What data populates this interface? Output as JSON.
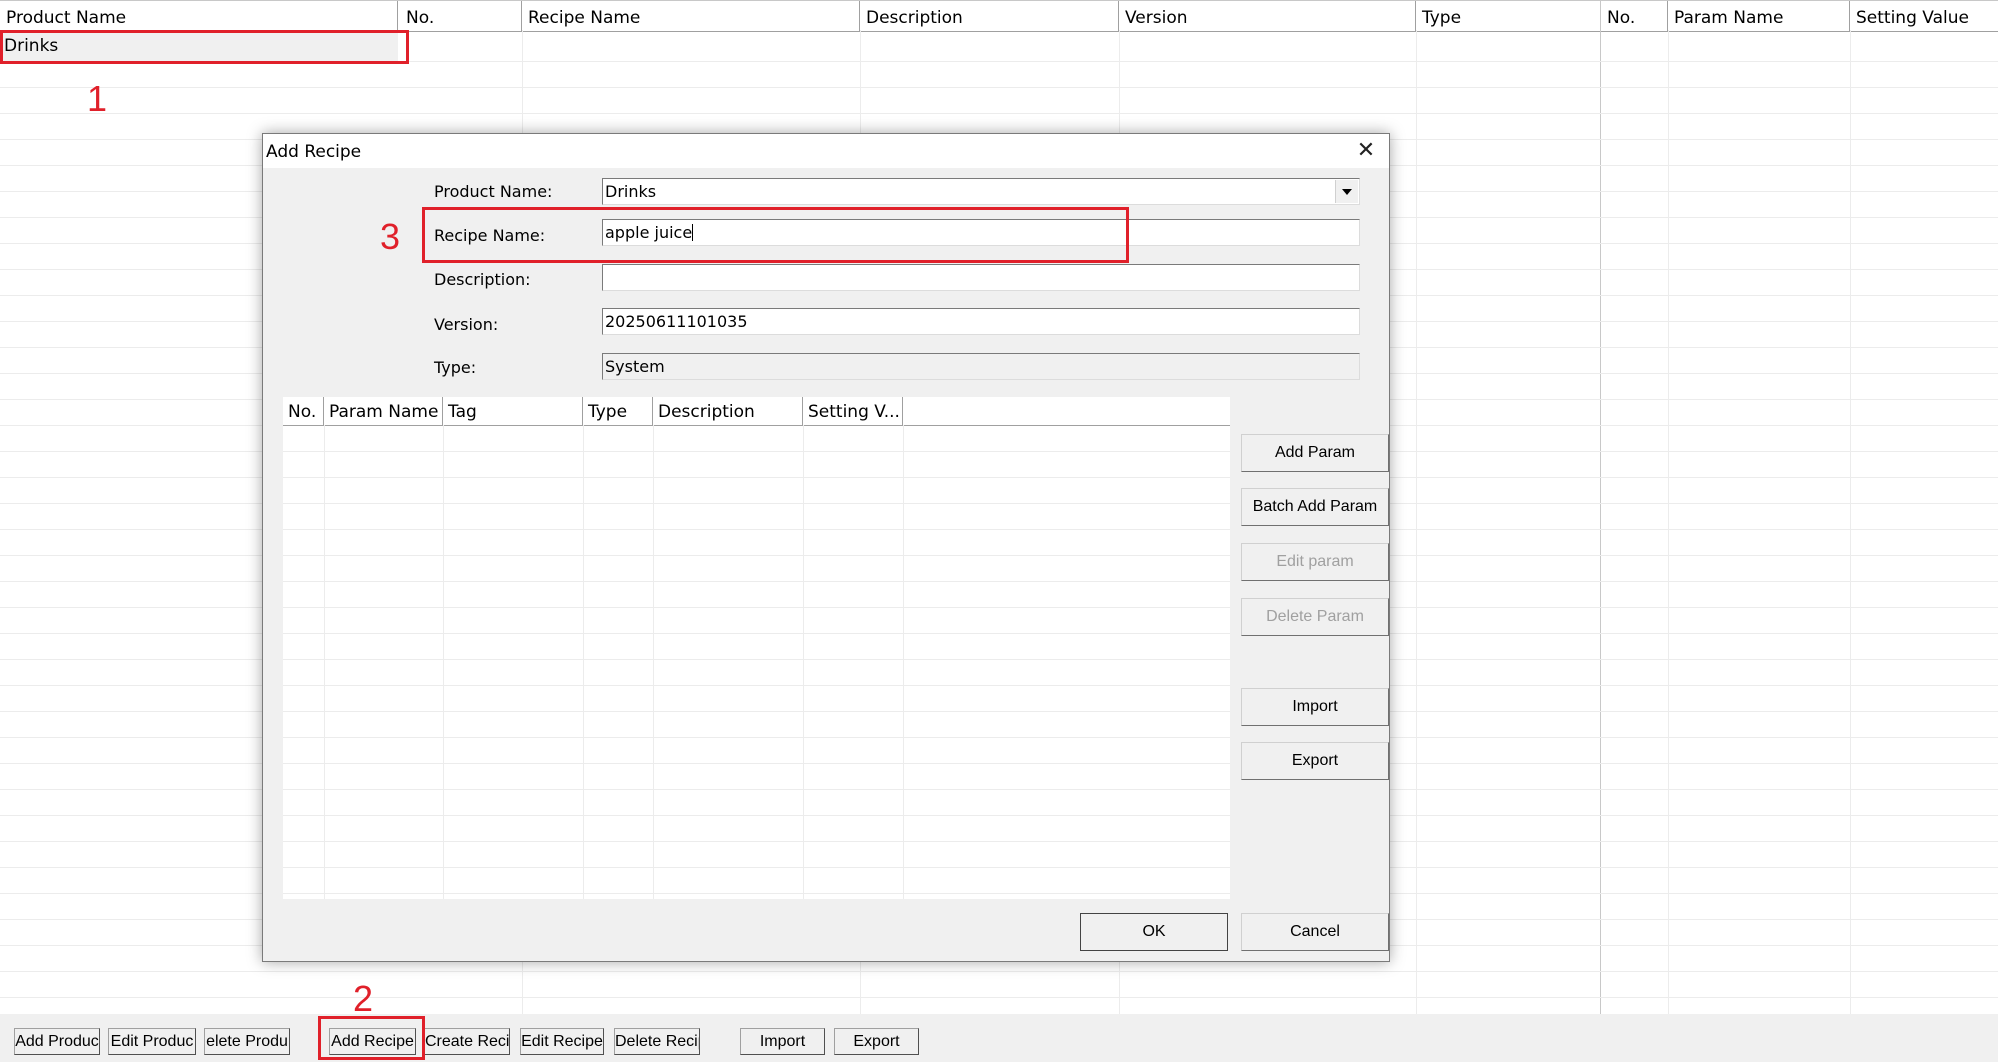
{
  "products_grid": {
    "header": "Product Name",
    "rows": [
      "Drinks"
    ]
  },
  "recipes_grid": {
    "headers": [
      "No.",
      "Recipe Name",
      "Description",
      "Version",
      "Type"
    ]
  },
  "params_grid": {
    "headers": [
      "No.",
      "Param Name",
      "Setting Value"
    ]
  },
  "toolbar": {
    "buttons": [
      "Add Produc",
      "Edit Produc",
      "elete Produ",
      "Add Recipe",
      "Create Recip",
      "Edit Recipe",
      "Delete Recip",
      "Import",
      "Export"
    ]
  },
  "dialog": {
    "title": "Add Recipe",
    "close_glyph": "✕",
    "labels": {
      "product_name": "Product Name:",
      "recipe_name": "Recipe Name:",
      "description": "Description:",
      "version": "Version:",
      "type": "Type:"
    },
    "values": {
      "product_name": "Drinks",
      "recipe_name": "apple juice",
      "description": "",
      "version": "20250611101035",
      "type": "System"
    },
    "param_table_headers": [
      "No.",
      "Param Name",
      "Tag",
      "Type",
      "Description",
      "Setting V..."
    ],
    "side_buttons": {
      "add_param": "Add Param",
      "batch_add_param": "Batch Add Param",
      "edit_param": "Edit param",
      "delete_param": "Delete Param",
      "import": "Import",
      "export": "Export"
    },
    "ok": "OK",
    "cancel": "Cancel"
  },
  "annotations": {
    "marker_1": "1",
    "marker_2": "2",
    "marker_3": "3",
    "color": "#e0202a"
  }
}
